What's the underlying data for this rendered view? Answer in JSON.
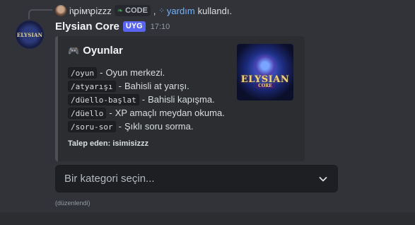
{
  "reply": {
    "username": "iꝕiᴍꝕizzz",
    "tag": "CODE",
    "separator": ",",
    "command": "yardım",
    "suffix": "kullandı."
  },
  "message": {
    "bot_name": "Elysian Core",
    "badge": "UYG",
    "timestamp": "17:10",
    "avatar_text": "ELYSIAN"
  },
  "embed": {
    "title": "Oyunlar",
    "commands": [
      {
        "cmd": "/oyun",
        "desc": "Oyun merkezi."
      },
      {
        "cmd": "/atyarışı",
        "desc": "Bahisli at yarışı."
      },
      {
        "cmd": "/düello-başlat",
        "desc": "Bahisli kapışma."
      },
      {
        "cmd": "/düello",
        "desc": "XP amaçlı meydan okuma."
      },
      {
        "cmd": "/soru-sor",
        "desc": "Şıklı soru sorma."
      }
    ],
    "dash": "-",
    "footer": "Talep eden: isimisizzz",
    "thumbnail_title": "ELYSIAN",
    "thumbnail_sub": "CORE"
  },
  "select": {
    "placeholder": "Bir kategori seçin..."
  },
  "edited_label": "(düzenlendi)",
  "colors": {
    "background": "#323339",
    "embed_bg": "#2b2d31",
    "badge": "#5865f2",
    "link": "#6fb4ff"
  }
}
